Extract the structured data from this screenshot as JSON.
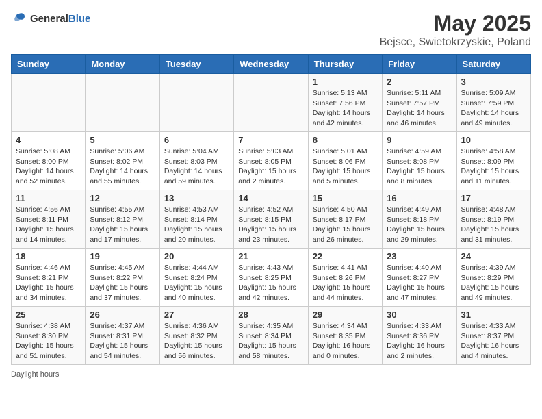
{
  "header": {
    "logo_general": "General",
    "logo_blue": "Blue",
    "title": "May 2025",
    "subtitle": "Bejsce, Swietokrzyskie, Poland"
  },
  "days_of_week": [
    "Sunday",
    "Monday",
    "Tuesday",
    "Wednesday",
    "Thursday",
    "Friday",
    "Saturday"
  ],
  "weeks": [
    [
      {
        "day": "",
        "info": ""
      },
      {
        "day": "",
        "info": ""
      },
      {
        "day": "",
        "info": ""
      },
      {
        "day": "",
        "info": ""
      },
      {
        "day": "1",
        "info": "Sunrise: 5:13 AM\nSunset: 7:56 PM\nDaylight: 14 hours and 42 minutes."
      },
      {
        "day": "2",
        "info": "Sunrise: 5:11 AM\nSunset: 7:57 PM\nDaylight: 14 hours and 46 minutes."
      },
      {
        "day": "3",
        "info": "Sunrise: 5:09 AM\nSunset: 7:59 PM\nDaylight: 14 hours and 49 minutes."
      }
    ],
    [
      {
        "day": "4",
        "info": "Sunrise: 5:08 AM\nSunset: 8:00 PM\nDaylight: 14 hours and 52 minutes."
      },
      {
        "day": "5",
        "info": "Sunrise: 5:06 AM\nSunset: 8:02 PM\nDaylight: 14 hours and 55 minutes."
      },
      {
        "day": "6",
        "info": "Sunrise: 5:04 AM\nSunset: 8:03 PM\nDaylight: 14 hours and 59 minutes."
      },
      {
        "day": "7",
        "info": "Sunrise: 5:03 AM\nSunset: 8:05 PM\nDaylight: 15 hours and 2 minutes."
      },
      {
        "day": "8",
        "info": "Sunrise: 5:01 AM\nSunset: 8:06 PM\nDaylight: 15 hours and 5 minutes."
      },
      {
        "day": "9",
        "info": "Sunrise: 4:59 AM\nSunset: 8:08 PM\nDaylight: 15 hours and 8 minutes."
      },
      {
        "day": "10",
        "info": "Sunrise: 4:58 AM\nSunset: 8:09 PM\nDaylight: 15 hours and 11 minutes."
      }
    ],
    [
      {
        "day": "11",
        "info": "Sunrise: 4:56 AM\nSunset: 8:11 PM\nDaylight: 15 hours and 14 minutes."
      },
      {
        "day": "12",
        "info": "Sunrise: 4:55 AM\nSunset: 8:12 PM\nDaylight: 15 hours and 17 minutes."
      },
      {
        "day": "13",
        "info": "Sunrise: 4:53 AM\nSunset: 8:14 PM\nDaylight: 15 hours and 20 minutes."
      },
      {
        "day": "14",
        "info": "Sunrise: 4:52 AM\nSunset: 8:15 PM\nDaylight: 15 hours and 23 minutes."
      },
      {
        "day": "15",
        "info": "Sunrise: 4:50 AM\nSunset: 8:17 PM\nDaylight: 15 hours and 26 minutes."
      },
      {
        "day": "16",
        "info": "Sunrise: 4:49 AM\nSunset: 8:18 PM\nDaylight: 15 hours and 29 minutes."
      },
      {
        "day": "17",
        "info": "Sunrise: 4:48 AM\nSunset: 8:19 PM\nDaylight: 15 hours and 31 minutes."
      }
    ],
    [
      {
        "day": "18",
        "info": "Sunrise: 4:46 AM\nSunset: 8:21 PM\nDaylight: 15 hours and 34 minutes."
      },
      {
        "day": "19",
        "info": "Sunrise: 4:45 AM\nSunset: 8:22 PM\nDaylight: 15 hours and 37 minutes."
      },
      {
        "day": "20",
        "info": "Sunrise: 4:44 AM\nSunset: 8:24 PM\nDaylight: 15 hours and 40 minutes."
      },
      {
        "day": "21",
        "info": "Sunrise: 4:43 AM\nSunset: 8:25 PM\nDaylight: 15 hours and 42 minutes."
      },
      {
        "day": "22",
        "info": "Sunrise: 4:41 AM\nSunset: 8:26 PM\nDaylight: 15 hours and 44 minutes."
      },
      {
        "day": "23",
        "info": "Sunrise: 4:40 AM\nSunset: 8:27 PM\nDaylight: 15 hours and 47 minutes."
      },
      {
        "day": "24",
        "info": "Sunrise: 4:39 AM\nSunset: 8:29 PM\nDaylight: 15 hours and 49 minutes."
      }
    ],
    [
      {
        "day": "25",
        "info": "Sunrise: 4:38 AM\nSunset: 8:30 PM\nDaylight: 15 hours and 51 minutes."
      },
      {
        "day": "26",
        "info": "Sunrise: 4:37 AM\nSunset: 8:31 PM\nDaylight: 15 hours and 54 minutes."
      },
      {
        "day": "27",
        "info": "Sunrise: 4:36 AM\nSunset: 8:32 PM\nDaylight: 15 hours and 56 minutes."
      },
      {
        "day": "28",
        "info": "Sunrise: 4:35 AM\nSunset: 8:34 PM\nDaylight: 15 hours and 58 minutes."
      },
      {
        "day": "29",
        "info": "Sunrise: 4:34 AM\nSunset: 8:35 PM\nDaylight: 16 hours and 0 minutes."
      },
      {
        "day": "30",
        "info": "Sunrise: 4:33 AM\nSunset: 8:36 PM\nDaylight: 16 hours and 2 minutes."
      },
      {
        "day": "31",
        "info": "Sunrise: 4:33 AM\nSunset: 8:37 PM\nDaylight: 16 hours and 4 minutes."
      }
    ]
  ],
  "footer": {
    "note": "Daylight hours"
  }
}
